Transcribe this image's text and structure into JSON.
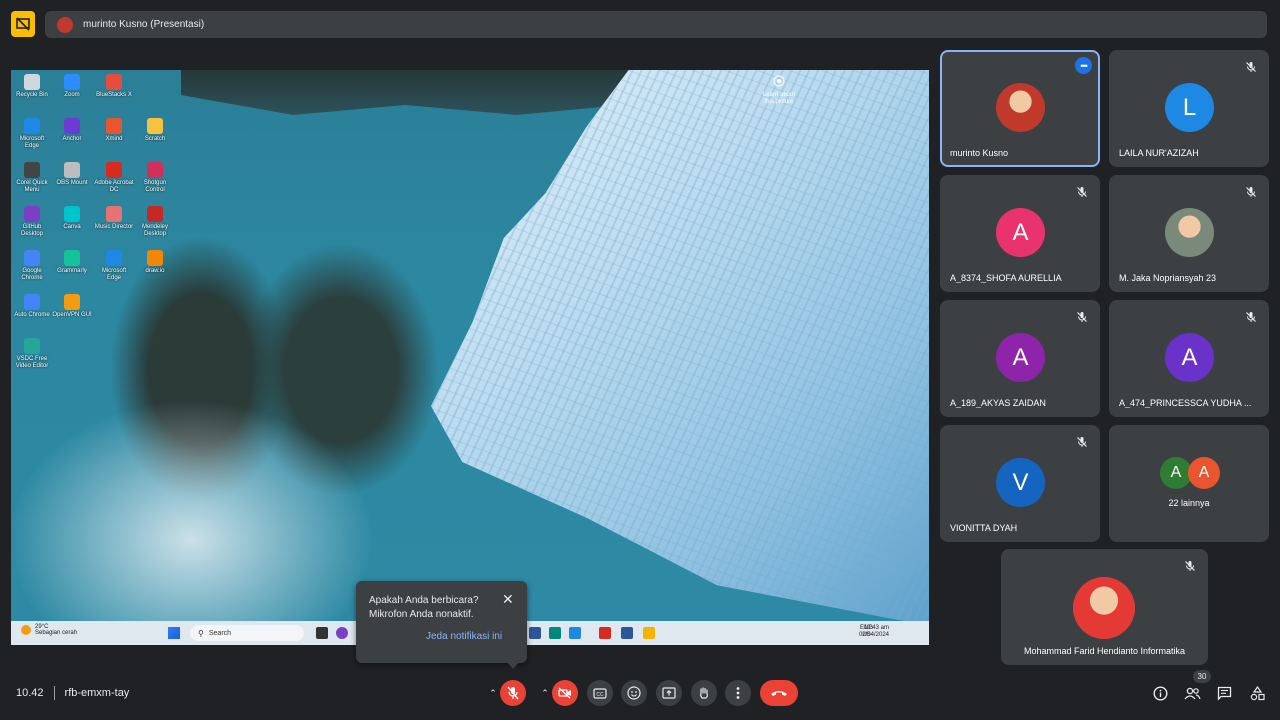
{
  "presentation": {
    "title": "murinto Kusno (Presentasi)"
  },
  "desktop": {
    "icons": [
      {
        "label": "Recycle Bin",
        "color": "#d0d7de"
      },
      {
        "label": "Zoom",
        "color": "#2d8cff"
      },
      {
        "label": "BlueStacks X",
        "color": "#e74c3c"
      },
      {
        "label": "Microsoft Edge",
        "color": "#1e88e5"
      },
      {
        "label": "Anchor",
        "color": "#6c3bd1"
      },
      {
        "label": "Xmind",
        "color": "#e8552e"
      },
      {
        "label": "Scratch",
        "color": "#f7c240"
      },
      {
        "label": "Corel Quick Menu",
        "color": "#444444"
      },
      {
        "label": "OBS Mount",
        "color": "#bdbdbd"
      },
      {
        "label": "Adobe Acrobat DC",
        "color": "#d62b1e"
      },
      {
        "label": "Shotgun Control",
        "color": "#d32f5b"
      },
      {
        "label": "GitHub Desktop",
        "color": "#7b3fc4"
      },
      {
        "label": "Canva",
        "color": "#00c4cc"
      },
      {
        "label": "Music Director",
        "color": "#e57373"
      },
      {
        "label": "Mendeley Desktop",
        "color": "#c62828"
      },
      {
        "label": "Google Chrome",
        "color": "#4285f4"
      },
      {
        "label": "Grammarly",
        "color": "#15c39a"
      },
      {
        "label": "Microsoft Edge",
        "color": "#1e88e5"
      },
      {
        "label": "draw.io",
        "color": "#f08705"
      },
      {
        "label": "Auto Chrome",
        "color": "#4285f4"
      },
      {
        "label": "OpenVPN GUI",
        "color": "#f39c12"
      },
      {
        "label": "VSDC Free Video Editor",
        "color": "#26a69a"
      }
    ],
    "recycle_label": "Learn about this picture"
  },
  "taskbar": {
    "temperature": "29°C",
    "weather": "Sebagian cerah",
    "search_placeholder": "Search",
    "lang": "ENG",
    "region": "US",
    "time": "10:43 am",
    "date": "02/04/2024"
  },
  "notification": {
    "line1": "Apakah Anda berbicara?",
    "line2": "Mikrofon Anda nonaktif.",
    "action": "Jeda notifikasi ini"
  },
  "participants": [
    {
      "name": "murinto Kusno",
      "initial": "",
      "color": "#c0392b",
      "photo": true,
      "active": true
    },
    {
      "name": "LAILA NUR'AZIZAH",
      "initial": "L",
      "color": "#1e88e5"
    },
    {
      "name": "A_8374_SHOFA AURELLIA",
      "initial": "A",
      "color": "#e8336f"
    },
    {
      "name": "M. Jaka Nopriansyah 23",
      "initial": "",
      "color": "#7a8a7a",
      "photo": true
    },
    {
      "name": "A_189_AKYAS ZAIDAN",
      "initial": "A",
      "color": "#8e24aa"
    },
    {
      "name": "A_474_PRINCESSCA YUDHA ...",
      "initial": "A",
      "color": "#6a32c9"
    },
    {
      "name": "VIONITTA DYAH",
      "initial": "V",
      "color": "#1565c0"
    },
    {
      "name": "Mohammad Farid Hendianto Informatika",
      "initial": "",
      "color": "#e53935",
      "photo": true
    }
  ],
  "others": {
    "label": "22 lainnya",
    "avatars": [
      {
        "initial": "A",
        "color": "#2e7d32"
      },
      {
        "initial": "A",
        "color": "#e8552e"
      }
    ]
  },
  "meeting": {
    "time": "10.42",
    "code": "rfb-emxm-tay",
    "people_count": "30"
  }
}
